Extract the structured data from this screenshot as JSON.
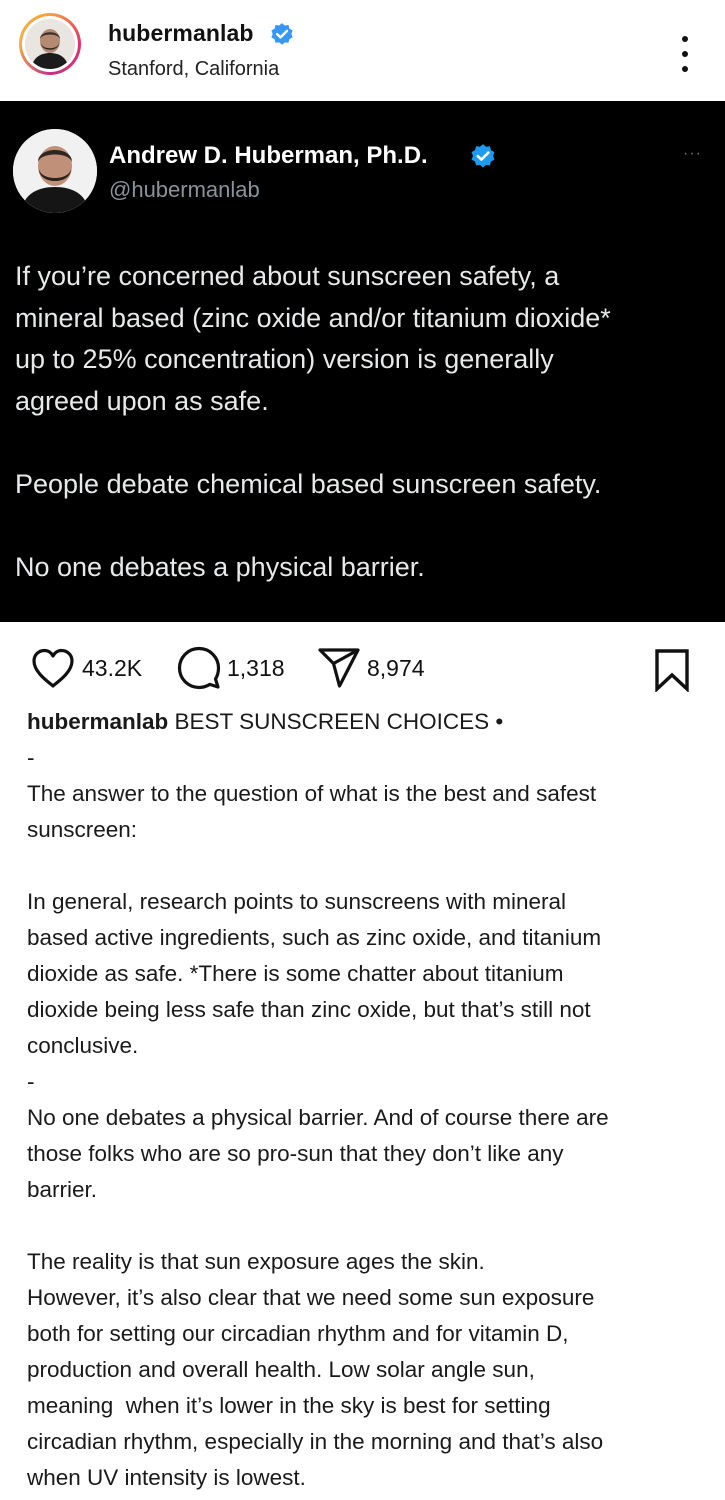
{
  "header": {
    "username": "hubermanlab",
    "location": "Stanford, California",
    "verified_color": "#3897f0",
    "more_icon": "more-vertical-icon"
  },
  "tweet": {
    "display_name": "Andrew D. Huberman, Ph.D.",
    "handle": "@hubermanlab",
    "more": "···",
    "verified_color": "#1d9bf0",
    "text": "If you’re concerned about sunscreen safety, a\nmineral based (zinc oxide and/or titanium dioxide*\nup to 25% concentration) version is generally\nagreed upon as safe.\n\nPeople debate chemical based sunscreen safety.\n\nNo one debates a physical barrier."
  },
  "actions": {
    "likes": "43.2K",
    "comments": "1,318",
    "shares": "8,974",
    "icons": [
      "heart-icon",
      "comment-icon",
      "share-icon",
      "bookmark-icon"
    ]
  },
  "caption": {
    "author": "hubermanlab",
    "title": " BEST SUNSCREEN CHOICES •",
    "body": "-\nThe answer to the question of what is the best and safest\nsunscreen:\n\nIn general, research points to sunscreens with mineral\nbased active ingredients, such as zinc oxide, and titanium\ndioxide as safe. *There is some chatter about titanium\ndioxide being less safe than zinc oxide, but that’s still not\nconclusive.\n-\nNo one debates a physical barrier. And of course there are\nthose folks who are so pro-sun that they don’t like any\nbarrier.\n\nThe reality is that sun exposure ages the skin.\nHowever, it’s also clear that we need some sun exposure\nboth for setting our circadian rhythm and for vitamin D,\nproduction and overall health. Low solar angle sun,\nmeaning  when it’s lower in the sky is best for setting\ncircadian rhythm, especially in the morning and that’s also\nwhen UV intensity is lowest."
  }
}
